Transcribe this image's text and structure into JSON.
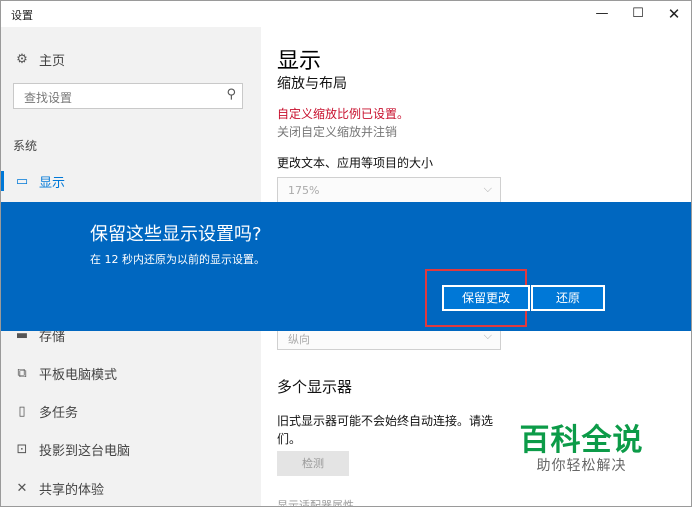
{
  "window": {
    "title": "设置",
    "min_glyph": "—",
    "max_glyph": "☐",
    "close_glyph": "✕"
  },
  "sidebar": {
    "home": {
      "label": "主页",
      "icon": "gear-icon"
    },
    "search": {
      "placeholder": "查找设置",
      "icon": "search-icon"
    },
    "section": "系统",
    "items": [
      {
        "label": "显示",
        "icon": "monitor-icon",
        "selected": true
      },
      {
        "label": "存储",
        "icon": "storage-icon"
      },
      {
        "label": "平板电脑模式",
        "icon": "tablet-icon"
      },
      {
        "label": "多任务",
        "icon": "multitask-icon"
      },
      {
        "label": "投影到这台电脑",
        "icon": "project-icon"
      },
      {
        "label": "共享的体验",
        "icon": "share-icon"
      }
    ]
  },
  "main": {
    "title": "显示",
    "subtitle": "缩放与布局",
    "warning": "自定义缩放比例已设置。",
    "link": "关闭自定义缩放并注销",
    "scale_label": "更改文本、应用等项目的大小",
    "scale_value": "175%",
    "orientation_value": "纵向",
    "multi_title": "多个显示器",
    "multi_text": "旧式显示器可能不会始终自动连接。请选择检测以尝试连接到它们。",
    "multi_text_visible": "旧式显示器可能不会始终自动连接。请选",
    "multi_text_line2": "们。",
    "detect_label": "检测",
    "advanced_link": "显示适配器属性"
  },
  "dialog": {
    "title": "保留这些显示设置吗?",
    "subtitle": "在 12 秒内还原为以前的显示设置。",
    "keep_label": "保留更改",
    "revert_label": "还原"
  },
  "watermark": {
    "main": "百科全说",
    "sub": "助你轻松解决"
  },
  "colors": {
    "accent": "#0078d7",
    "dialog_bg": "#0067c0",
    "warning": "#c8102e",
    "highlight_box": "#e0393e",
    "watermark_green": "#0c9b48"
  }
}
